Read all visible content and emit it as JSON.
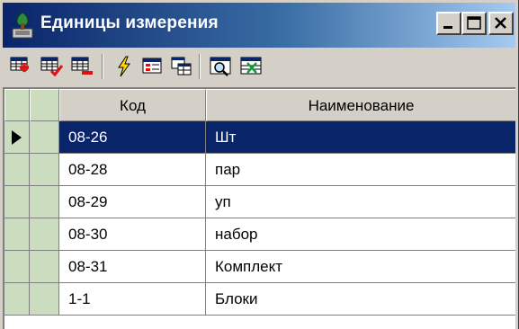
{
  "window": {
    "title": "Единицы измерения",
    "controls": {
      "minimize": "minimize",
      "maximize": "maximize",
      "close": "close"
    }
  },
  "toolbar": {
    "buttons": [
      {
        "icon": "add-record-icon"
      },
      {
        "icon": "edit-record-icon"
      },
      {
        "icon": "delete-record-icon"
      },
      {
        "icon": "lightning-icon"
      },
      {
        "icon": "form-view-icon"
      },
      {
        "icon": "copy-table-icon"
      },
      {
        "icon": "search-icon"
      },
      {
        "icon": "close-table-icon"
      }
    ]
  },
  "grid": {
    "columns": [
      "Код",
      "Наименование"
    ],
    "selected_row": 0,
    "rows": [
      {
        "code": "08-26",
        "name": "Шт"
      },
      {
        "code": "08-28",
        "name": "пар"
      },
      {
        "code": "08-29",
        "name": "уп"
      },
      {
        "code": "08-30",
        "name": "набор"
      },
      {
        "code": "08-31",
        "name": "Комплект"
      },
      {
        "code": "1-1",
        "name": "Блоки"
      }
    ]
  },
  "colors": {
    "selection": "#0a246a",
    "indicator_column": "#ccdcbf",
    "titlebar_start": "#0a246a",
    "titlebar_end": "#a6caf0"
  }
}
